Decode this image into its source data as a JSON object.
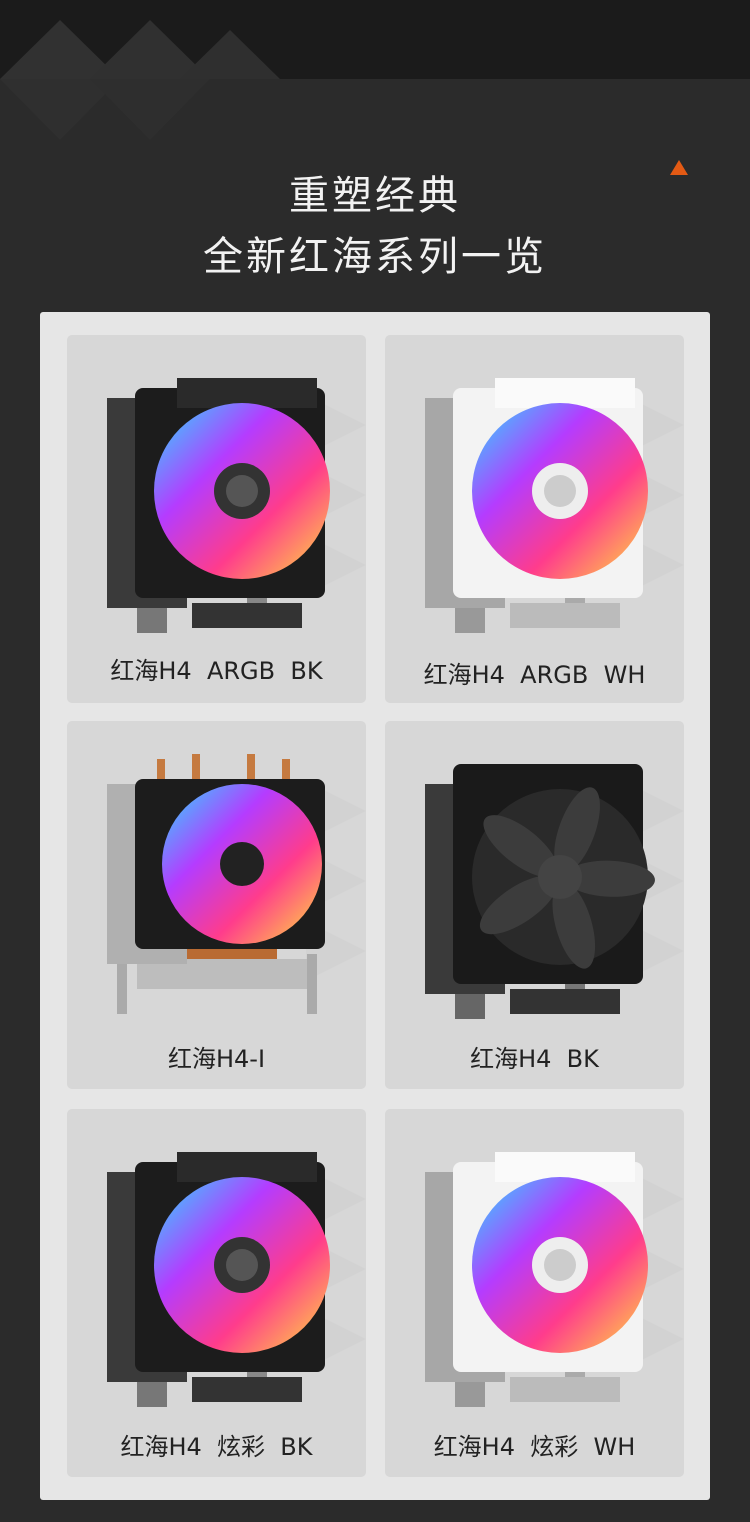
{
  "heading": {
    "line1": "重塑经典",
    "line2": "全新红海系列一览"
  },
  "colors": {
    "accent": "#e35a14",
    "background": "#2b2b2b",
    "panel": "#e6e6e6",
    "card": "#d7d7d7"
  },
  "products": [
    {
      "name": "红海H4  ARGB  BK",
      "variant": "argb-black"
    },
    {
      "name": "红海H4  ARGB  WH",
      "variant": "argb-white"
    },
    {
      "name": "红海H4-I",
      "variant": "copper-argb"
    },
    {
      "name": "红海H4  BK",
      "variant": "plain-black"
    },
    {
      "name": "红海H4  炫彩  BK",
      "variant": "argb-black"
    },
    {
      "name": "红海H4  炫彩  WH",
      "variant": "argb-white"
    }
  ]
}
